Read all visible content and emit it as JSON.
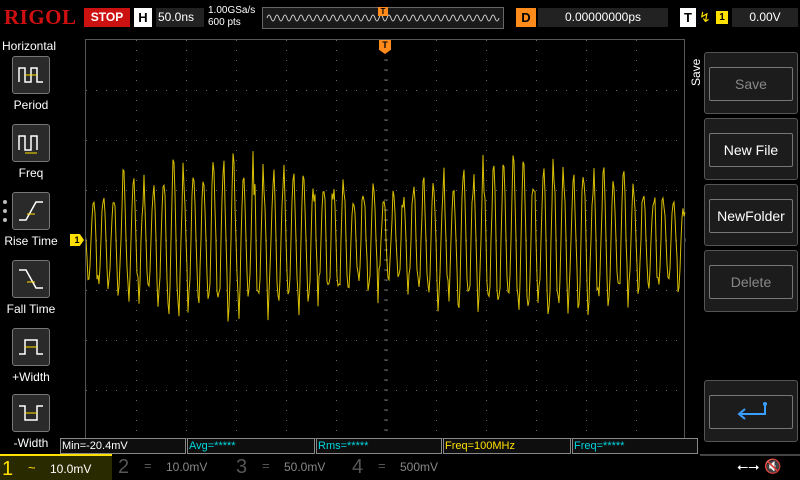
{
  "brand": "RIGOL",
  "run_state": "STOP",
  "horizontal": {
    "label": "H",
    "timebase": "50.0ns",
    "sample_rate": "1.00GSa/s",
    "memory_depth": "600 pts"
  },
  "delay": {
    "label": "D",
    "value": "0.00000000ps"
  },
  "trigger": {
    "label": "T",
    "edge": "rising-edge-icon",
    "source": "1",
    "level": "0.00V"
  },
  "left_menu": {
    "title": "Horizontal",
    "items": [
      {
        "label": "Period",
        "icon": "period-icon"
      },
      {
        "label": "Freq",
        "icon": "freq-icon"
      },
      {
        "label": "Rise Time",
        "icon": "rise-time-icon"
      },
      {
        "label": "Fall Time",
        "icon": "fall-time-icon"
      },
      {
        "label": "+Width",
        "icon": "pos-width-icon"
      },
      {
        "label": "-Width",
        "icon": "neg-width-icon"
      }
    ]
  },
  "right_menu": {
    "title": "Save",
    "buttons": [
      {
        "label": "Save",
        "enabled": false
      },
      {
        "label": "New File",
        "enabled": true
      },
      {
        "label": "NewFolder",
        "enabled": true
      },
      {
        "label": "Delete",
        "enabled": false
      }
    ],
    "return_icon": "return-arrow-icon"
  },
  "measurements": [
    {
      "text": "Min=-20.4mV",
      "color": "#ffe000"
    },
    {
      "text": "Avg=*****",
      "color": "#00d8e0"
    },
    {
      "text": "Rms=*****",
      "color": "#00d8e0"
    },
    {
      "text": "Freq=100MHz",
      "color": "#ffe000"
    },
    {
      "text": "Freq=*****",
      "color": "#00d8e0"
    }
  ],
  "channels": [
    {
      "num": "1",
      "scale": "10.0mV",
      "active": true,
      "color": "#ffe000"
    },
    {
      "num": "2",
      "scale": "10.0mV",
      "active": false,
      "color": "#00d8e0"
    },
    {
      "num": "3",
      "scale": "50.0mV",
      "active": false,
      "color": "#e020e0"
    },
    {
      "num": "4",
      "scale": "500mV",
      "active": false,
      "color": "#2080ff"
    }
  ],
  "markers": {
    "ch1": "1",
    "trigger_level": "T",
    "trigger_pos": "T"
  },
  "status_icons": [
    "usb-icon",
    "speaker-muted-icon"
  ],
  "colors": {
    "ch1": "#ffe000",
    "trigger": "#ff8c1a",
    "stop": "#cc1111",
    "brand": "#d01010"
  }
}
